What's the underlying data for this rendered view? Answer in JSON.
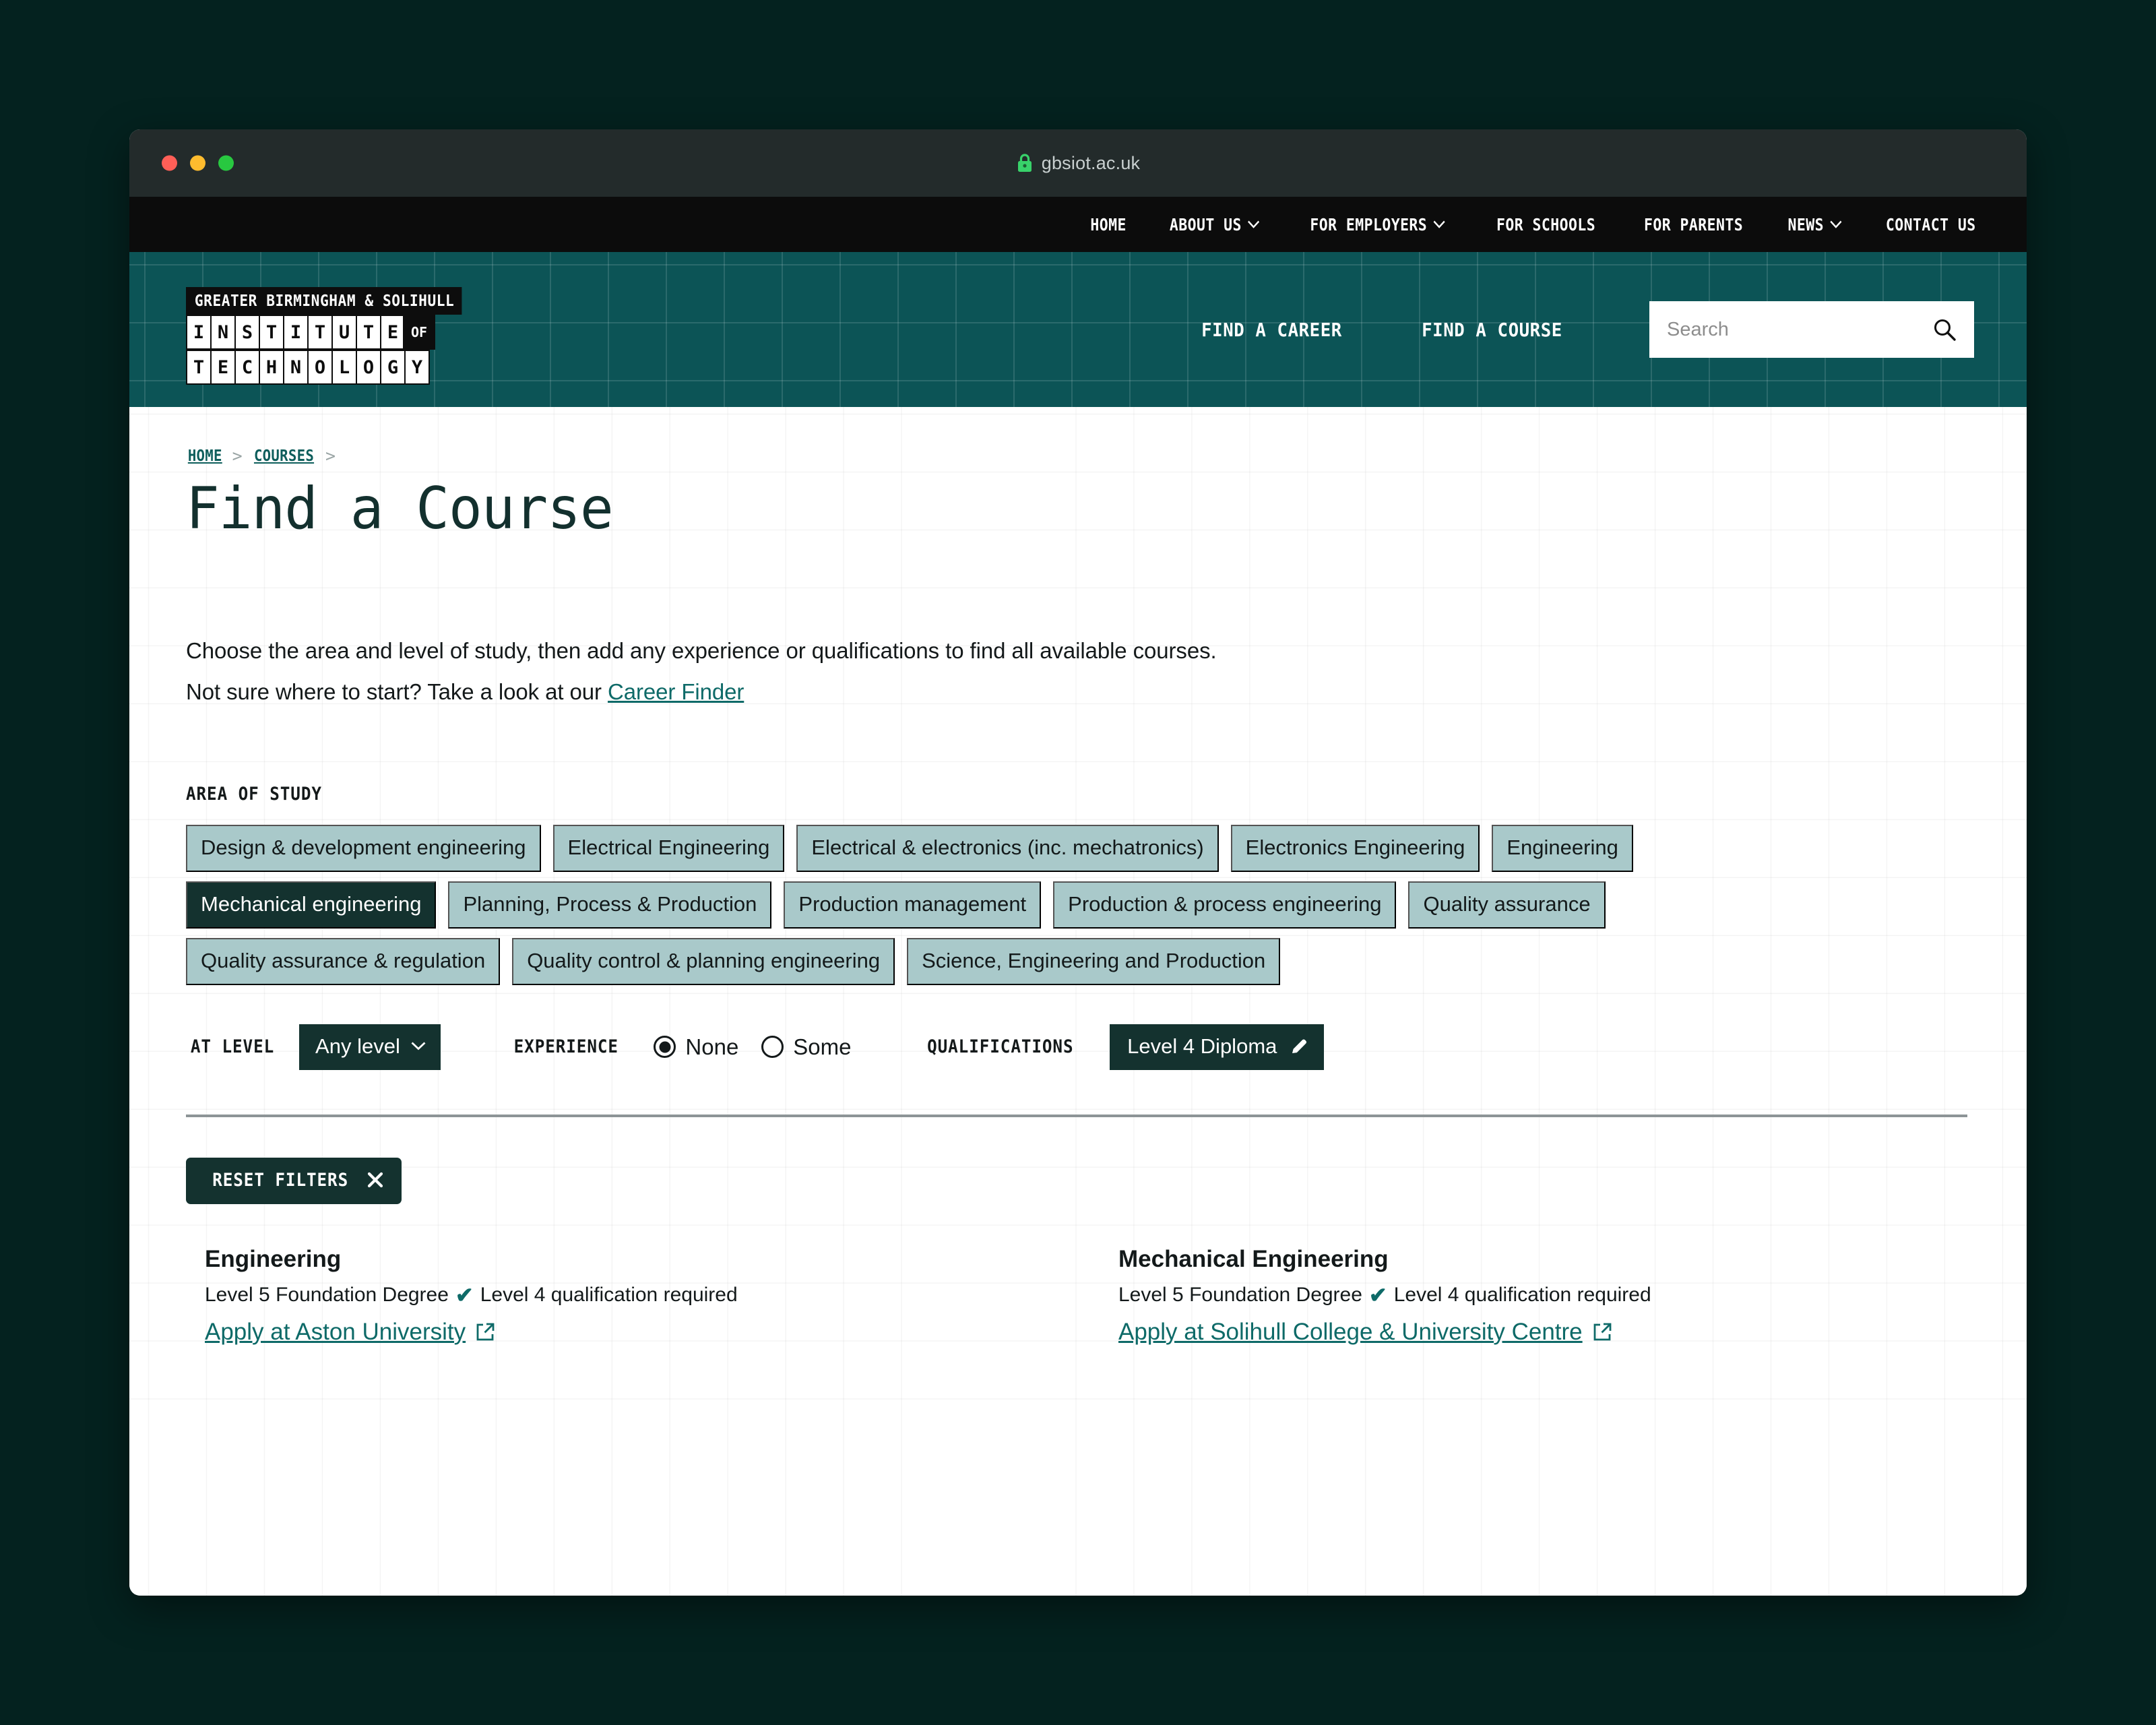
{
  "browser": {
    "url": "gbsiot.ac.uk",
    "lock_icon": "lock-icon",
    "traffic_lights": [
      "close-red",
      "minimize-amber",
      "maximize-green"
    ]
  },
  "topnav": {
    "items": [
      {
        "label": "HOME",
        "has_chevron": false
      },
      {
        "label": "ABOUT US",
        "has_chevron": true
      },
      {
        "label": "FOR EMPLOYERS",
        "has_chevron": true
      },
      {
        "label": "FOR SCHOOLS",
        "has_chevron": false
      },
      {
        "label": "FOR PARENTS",
        "has_chevron": false
      },
      {
        "label": "NEWS",
        "has_chevron": true
      },
      {
        "label": "CONTACT US",
        "has_chevron": false
      }
    ]
  },
  "masthead": {
    "logo": {
      "top_line": "GREATER BIRMINGHAM & SOLIHULL",
      "word_one": "INSTITUTE",
      "of_label": "OF",
      "word_two": "TECHNOLOGY"
    },
    "links": [
      "FIND A CAREER",
      "FIND A COURSE"
    ],
    "search": {
      "placeholder": "Search",
      "value": "",
      "icon": "search-icon"
    }
  },
  "breadcrumb": {
    "items": [
      "HOME",
      "COURSES"
    ],
    "separator": ">"
  },
  "page": {
    "title": "Find a Course",
    "intro_line_1": "Choose the area and level of study, then add any experience or qualifications to find all available courses.",
    "intro_line_2_prefix": "Not sure where to start? Take a look at our ",
    "intro_link": "Career Finder"
  },
  "filters": {
    "area_of_study_label": "AREA OF STUDY",
    "chips": [
      {
        "label": "Design & development engineering",
        "selected": false
      },
      {
        "label": "Electrical Engineering",
        "selected": false
      },
      {
        "label": "Electrical & electronics (inc. mechatronics)",
        "selected": false
      },
      {
        "label": "Electronics Engineering",
        "selected": false
      },
      {
        "label": "Engineering",
        "selected": false
      },
      {
        "label": "Mechanical engineering",
        "selected": true
      },
      {
        "label": "Planning, Process & Production",
        "selected": false
      },
      {
        "label": "Production management",
        "selected": false
      },
      {
        "label": "Production & process engineering",
        "selected": false
      },
      {
        "label": "Quality assurance",
        "selected": false
      },
      {
        "label": "Quality assurance & regulation",
        "selected": false
      },
      {
        "label": "Quality control & planning engineering",
        "selected": false
      },
      {
        "label": "Science, Engineering and Production",
        "selected": false
      }
    ],
    "at_level_label": "AT LEVEL",
    "level_value": "Any level",
    "level_chevron_icon": "chevron-down-icon",
    "experience_label": "EXPERIENCE",
    "experience_options": [
      {
        "label": "None",
        "selected": true
      },
      {
        "label": "Some",
        "selected": false
      }
    ],
    "qualifications_label": "QUALIFICATIONS",
    "qualification_value": "Level 4 Diploma",
    "qualification_edit_icon": "pencil-icon",
    "reset_label": "RESET FILTERS",
    "reset_icon": "close-x-icon"
  },
  "results": [
    {
      "title": "Engineering",
      "level": "Level 5 Foundation Degree",
      "requirement": "Level 4 qualification required",
      "tick_icon": "check-icon",
      "apply_label": "Apply at Aston University",
      "external_icon": "external-link-icon"
    },
    {
      "title": "Mechanical Engineering",
      "level": "Level 5 Foundation Degree",
      "requirement": "Level 4 qualification required",
      "tick_icon": "check-icon",
      "apply_label": "Apply at Solihull College & University Centre",
      "external_icon": "external-link-icon"
    }
  ],
  "colors": {
    "page_background": "#04221f",
    "teal_masthead": "#0c5456",
    "dark_teal_accent": "#14322f",
    "chip_background": "#a9c9ca",
    "link_teal": "#0e6a68",
    "topnav_black": "#0c0c0c"
  }
}
